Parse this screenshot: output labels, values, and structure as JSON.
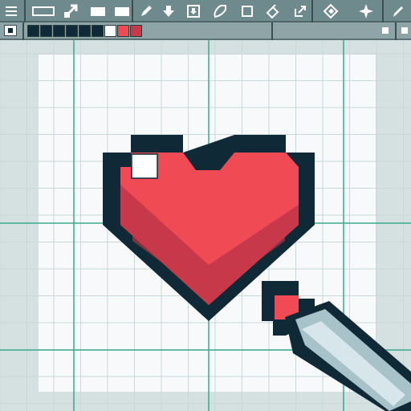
{
  "app": {
    "name": "pixel-editor"
  },
  "toolbar": {
    "tools": [
      {
        "name": "menu-icon"
      },
      {
        "name": "rectangle-select-icon"
      },
      {
        "name": "transform-icon"
      },
      {
        "name": "fill-rect-icon"
      },
      {
        "name": "fill-rect-alt-icon"
      },
      {
        "name": "pen-icon"
      },
      {
        "name": "arrow-down-icon"
      },
      {
        "name": "import-icon"
      },
      {
        "name": "lasso-icon"
      },
      {
        "name": "square-icon"
      },
      {
        "name": "fill-bucket-icon"
      },
      {
        "name": "export-icon"
      },
      {
        "name": "eraser-icon"
      },
      {
        "name": "move-icon"
      },
      {
        "name": "brush-icon"
      }
    ]
  },
  "palette": {
    "swatches": [
      "#0f2a36",
      "#0f2a36",
      "#0f2a36",
      "#0f2a36",
      "#0f2a36",
      "#0f2a36",
      "#ffffff",
      "#f04a55",
      "#c7384a"
    ],
    "primary": "#0f2a36",
    "secondary": "#ffffff"
  },
  "colors": {
    "outline": "#0f2a36",
    "heart_red": "#f04a55",
    "heart_shade": "#c7384a",
    "highlight": "#ffffff",
    "canvas_bg": "#f7f9fa",
    "grid_line": "#c9d8db",
    "guide_line": "#3fa88f",
    "pencil_body": "#a8c2ca"
  },
  "canvas": {
    "grid": true,
    "guides": true
  }
}
